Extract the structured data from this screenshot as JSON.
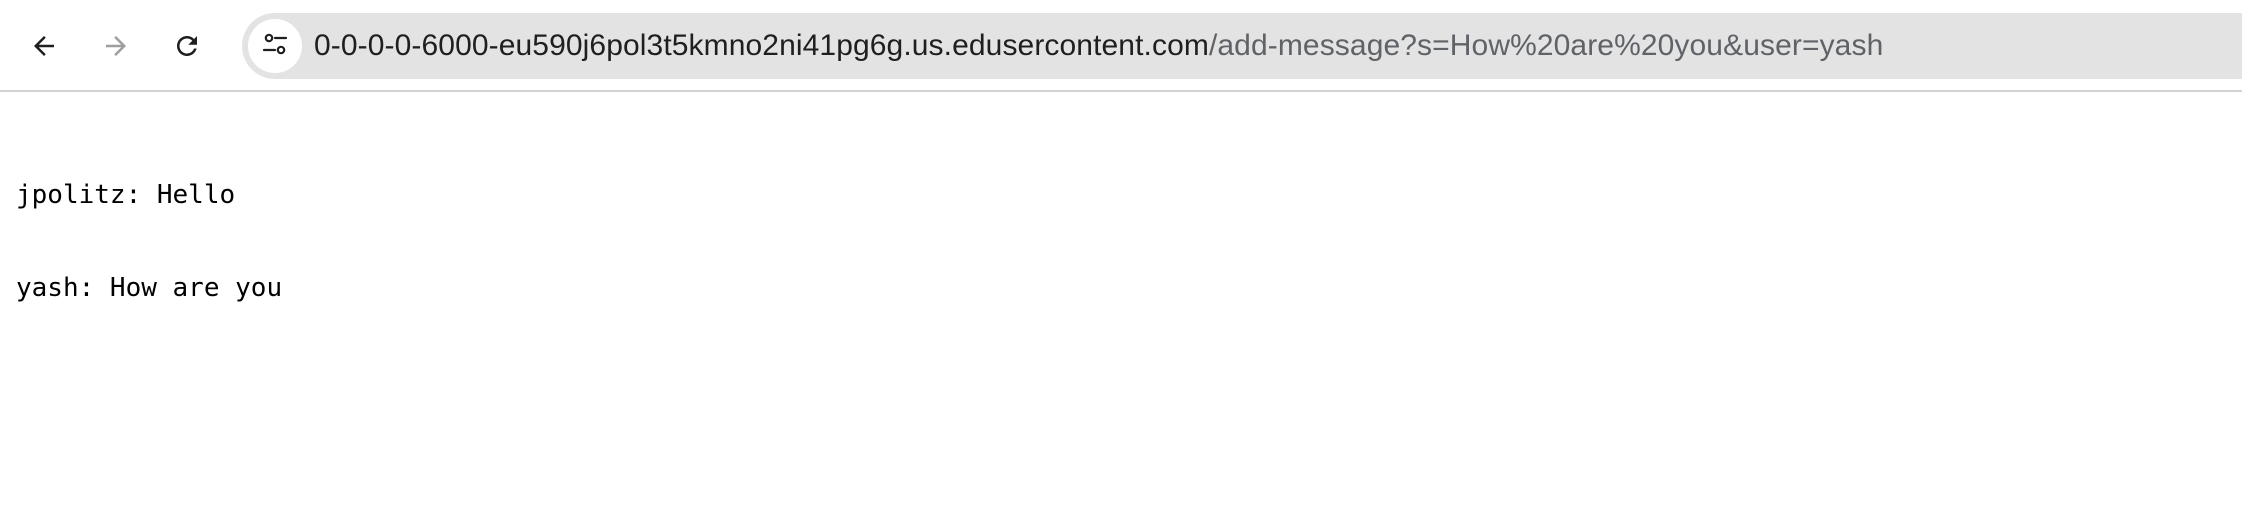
{
  "browser": {
    "back_icon": "arrow-left-icon",
    "forward_icon": "arrow-right-icon",
    "reload_icon": "reload-icon",
    "site_info_icon": "tune-icon",
    "url_host": "0-0-0-0-6000-eu590j6pol3t5kmno2ni41pg6g.us.edusercontent.com",
    "url_path": "/add-message?s=How%20are%20you&user=yash",
    "colors": {
      "host_text": "#1f1f1f",
      "path_text": "#5f6368",
      "omnibox_bg": "#e3e3e3",
      "forward_disabled": "#9e9e9e"
    }
  },
  "page": {
    "messages": [
      {
        "text": "jpolitz: Hello"
      },
      {
        "text": "yash: How are you"
      }
    ]
  }
}
